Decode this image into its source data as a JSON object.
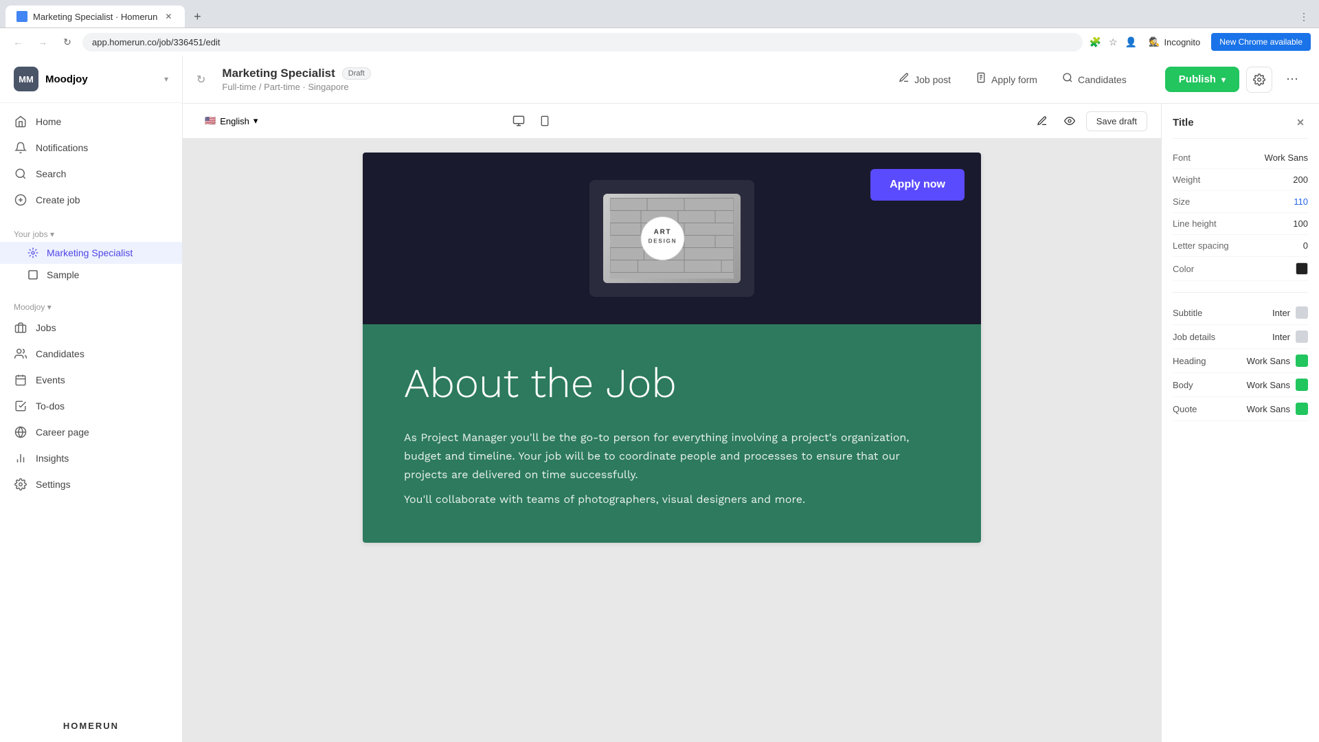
{
  "browser": {
    "tab_title": "Marketing Specialist · Homerun",
    "address": "app.homerun.co/job/336451/edit",
    "new_chrome_label": "New Chrome available",
    "incognito_label": "Incognito"
  },
  "sidebar": {
    "brand": "Moodjoy",
    "brand_initials": "MM",
    "nav_items": [
      {
        "id": "home",
        "label": "Home",
        "icon": "🏠"
      },
      {
        "id": "notifications",
        "label": "Notifications",
        "icon": "🔔"
      },
      {
        "id": "search",
        "label": "Search",
        "icon": "🔍"
      },
      {
        "id": "create-job",
        "label": "Create job",
        "icon": "➕"
      }
    ],
    "your_jobs_label": "Your jobs",
    "your_jobs_items": [
      {
        "id": "marketing-specialist",
        "label": "Marketing Specialist",
        "active": true
      },
      {
        "id": "sample",
        "label": "Sample",
        "active": false
      }
    ],
    "moodjoy_label": "Moodjoy",
    "moodjoy_items": [
      {
        "id": "jobs",
        "label": "Jobs",
        "icon": "💼"
      },
      {
        "id": "candidates",
        "label": "Candidates",
        "icon": "👥"
      },
      {
        "id": "events",
        "label": "Events",
        "icon": "📅"
      },
      {
        "id": "todos",
        "label": "To-dos",
        "icon": "☑️"
      },
      {
        "id": "career-page",
        "label": "Career page",
        "icon": "🌐"
      },
      {
        "id": "insights",
        "label": "Insights",
        "icon": "📊"
      },
      {
        "id": "settings",
        "label": "Settings",
        "icon": "⚙️"
      }
    ],
    "footer_logo": "HOMERUN"
  },
  "topbar": {
    "job_title": "Marketing Specialist",
    "draft_label": "Draft",
    "job_meta": "Full-time / Part-time · Singapore",
    "tabs": [
      {
        "id": "job-post",
        "label": "Job post",
        "icon": "✏️"
      },
      {
        "id": "apply-form",
        "label": "Apply form",
        "icon": "📋"
      },
      {
        "id": "candidates",
        "label": "Candidates",
        "icon": "🔍"
      }
    ],
    "publish_label": "Publish",
    "save_draft_label": "Save draft"
  },
  "canvas": {
    "language": "English",
    "apply_now_label": "Apply now",
    "company_logo_text": "ART\nDESIGN",
    "about_title": "About the Job",
    "about_body": "As Project Manager you'll be the go-to person for everything involving a project's organization, budget and timeline. Your job will be to coordinate people and processes to ensure that our projects are delivered on time successfully.\nYou'll collaborate with teams of photographers, visual designers and more."
  },
  "right_panel": {
    "section_title": "Title",
    "rows": [
      {
        "label": "Font",
        "value": "Work Sans",
        "type": "text"
      },
      {
        "label": "Weight",
        "value": "200",
        "type": "text"
      },
      {
        "label": "Size",
        "value": "110",
        "type": "text-blue"
      },
      {
        "label": "Line height",
        "value": "100",
        "type": "text"
      },
      {
        "label": "Letter spacing",
        "value": "0",
        "type": "text"
      },
      {
        "label": "Color",
        "value": "",
        "type": "color"
      }
    ],
    "font_rows": [
      {
        "label": "Subtitle",
        "value": "Inter",
        "toggle": false
      },
      {
        "label": "Job details",
        "value": "Inter",
        "toggle": false
      },
      {
        "label": "Heading",
        "value": "Work Sans",
        "toggle": true
      },
      {
        "label": "Body",
        "value": "Work Sans",
        "toggle": true
      },
      {
        "label": "Quote",
        "value": "Work Sans",
        "toggle": true
      }
    ]
  }
}
